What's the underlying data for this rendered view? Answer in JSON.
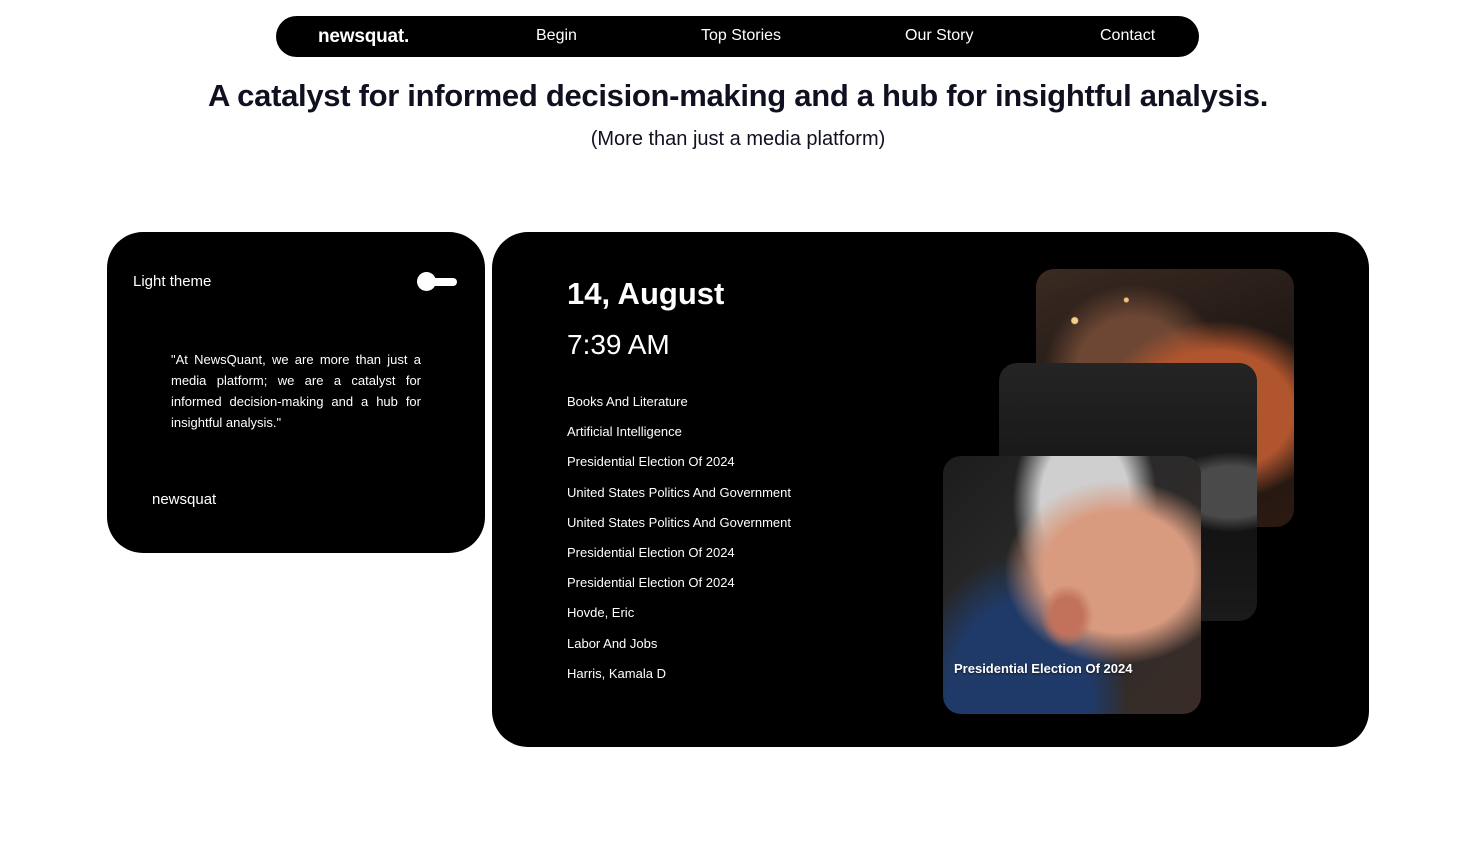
{
  "nav": {
    "brand": "newsquat.",
    "links": [
      "Begin",
      "Top Stories",
      "Our Story",
      "Contact"
    ]
  },
  "hero": {
    "headline": "A catalyst for informed decision-making and a hub for insightful analysis.",
    "subheadline": "(More than just a media platform)"
  },
  "sidebar_card": {
    "theme_label": "Light theme",
    "quote": "\"At NewsQuant, we are more than just a media platform; we are a catalyst for informed decision-making and a hub for insightful analysis.\"",
    "brand": "newsquat"
  },
  "feed_card": {
    "date": "14, August",
    "time": "7:39 AM",
    "topics": [
      "Books And Literature",
      "Artificial Intelligence",
      "Presidential Election Of 2024",
      "United States Politics And Government",
      "United States Politics And Government",
      "Presidential Election Of 2024",
      "Presidential Election Of 2024",
      "Hovde, Eric",
      "Labor And Jobs",
      "Harris, Kamala D"
    ],
    "image_caption": "Presidential Election Of 2024"
  }
}
